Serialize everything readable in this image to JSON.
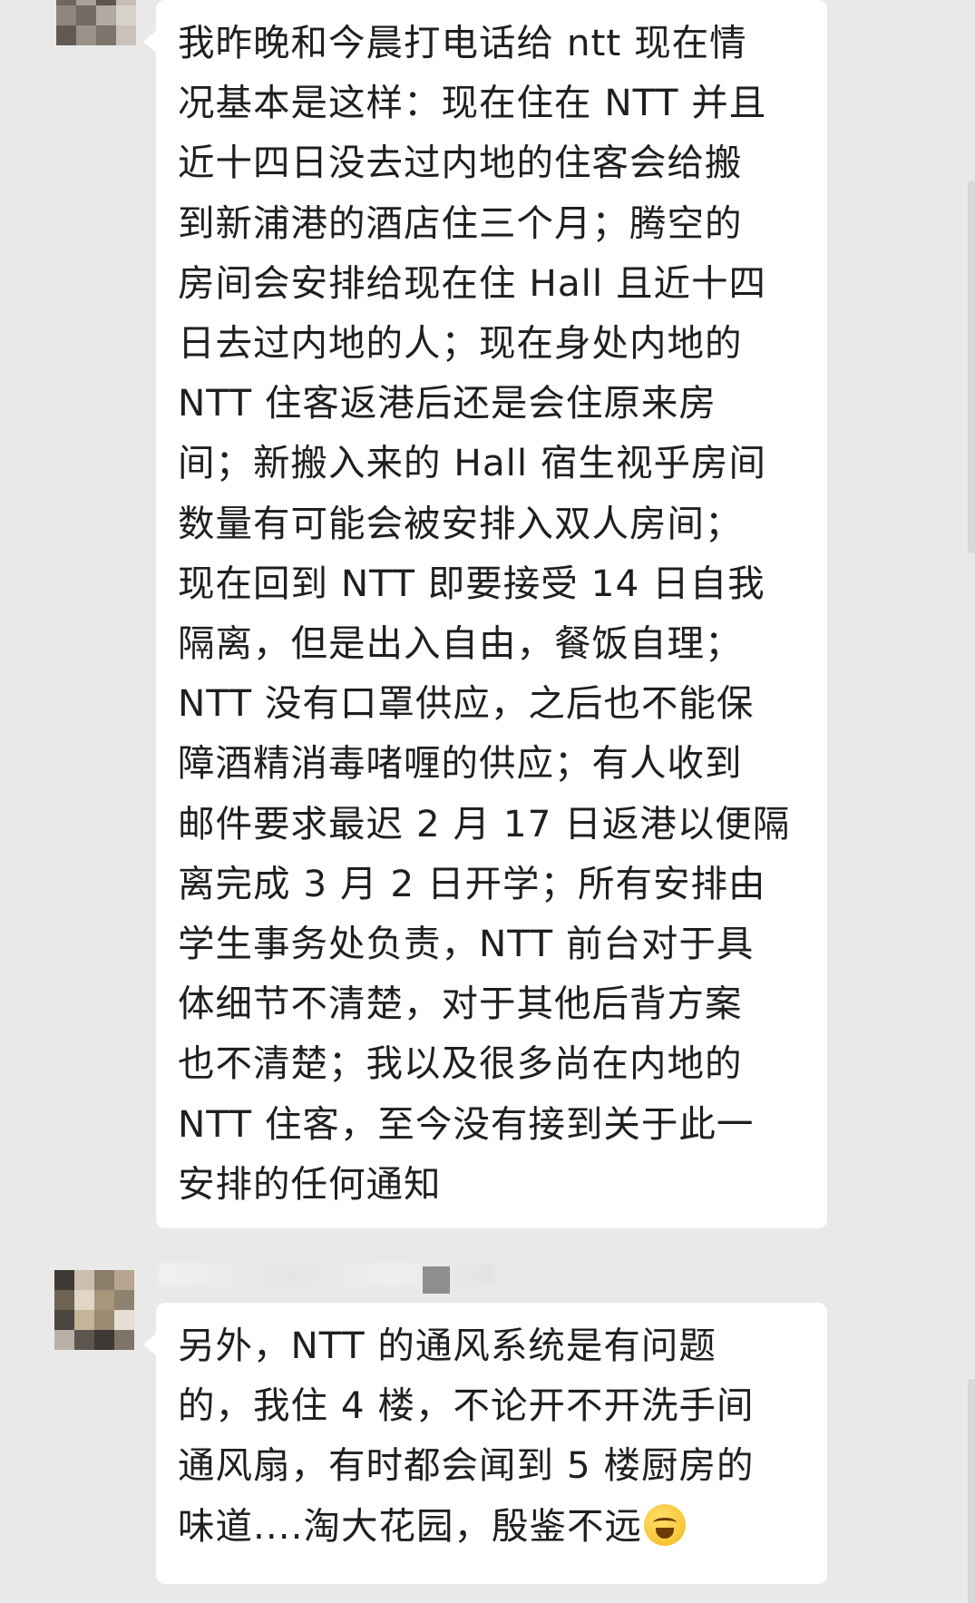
{
  "messages": [
    {
      "lines": [
        "我昨晚和今晨打电话给 ntt 现在情",
        "况基本是这样：现在住在 NTT 并且",
        "近十四日没去过内地的住客会给搬",
        "到新浦港的酒店住三个月；腾空的",
        "房间会安排给现在住 Hall 且近十四",
        "日去过内地的人；现在身处内地的",
        "NTT 住客返港后还是会住原来房",
        "间；新搬入来的 Hall 宿生视乎房间",
        "数量有可能会被安排入双人房间；",
        "现在回到 NTT 即要接受 14 日自我",
        "隔离，但是出入自由，餐饭自理；",
        "NTT 没有口罩供应，之后也不能保",
        "障酒精消毒啫喱的供应；有人收到",
        "邮件要求最迟 2 月 17 日返港以便隔",
        "离完成 3 月 2 日开学；所有安排由",
        "学生事务处负责，NTT 前台对于具",
        "体细节不清楚，对于其他后背方案",
        "也不清楚；我以及很多尚在内地的",
        "NTT 住客，至今没有接到关于此一",
        "安排的任何通知"
      ]
    },
    {
      "lines": [
        "另外，NTT 的通风系统是有问题",
        "的，我住 4 楼，不论开不开洗手间",
        "通风扇，有时都会闻到 5 楼厨房的",
        "味道....淘大花园，殷鉴不远"
      ],
      "emoji": "crying-laughing-emoji"
    }
  ],
  "colors": {
    "background": "#e9e9e9",
    "bubble": "#ffffff",
    "text": "#1f1f1f"
  }
}
